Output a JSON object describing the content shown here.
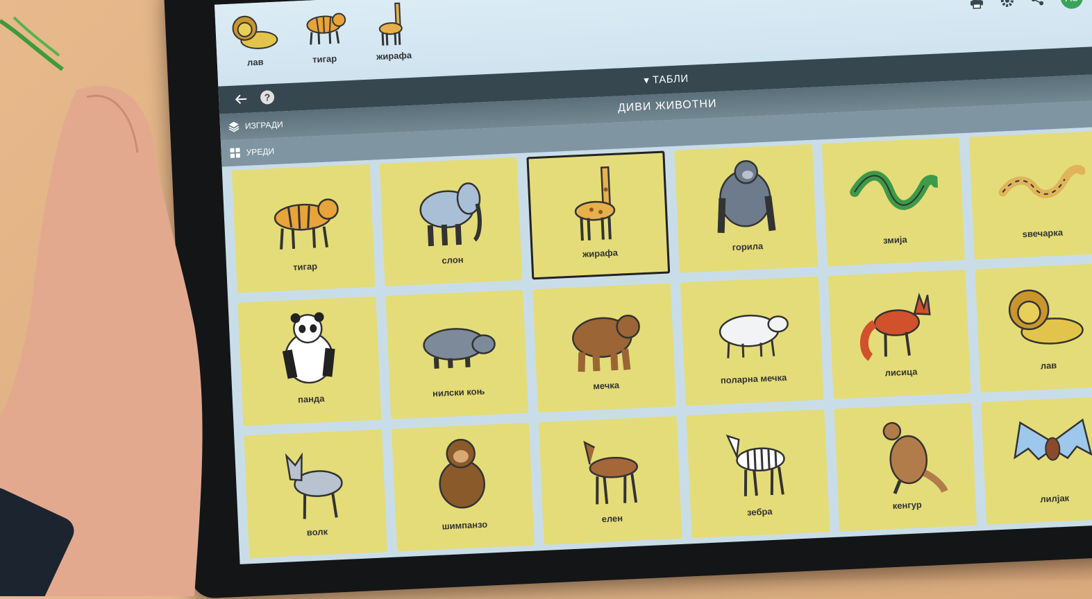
{
  "message_bar": {
    "items": [
      {
        "label": "лав",
        "icon": "lion-icon"
      },
      {
        "label": "тигар",
        "icon": "tiger-icon"
      },
      {
        "label": "жирафа",
        "icon": "giraffe-icon"
      }
    ],
    "avatar_initials": "AS",
    "tools": [
      "print-icon",
      "settings-icon",
      "share-icon"
    ]
  },
  "nav": {
    "boards_label": "ТАБЛИ"
  },
  "board": {
    "title": "ДИВИ ЖИВОТНИ",
    "build_label": "ИЗГРАДИ",
    "edit_label": "УРЕДИ"
  },
  "tiles": [
    {
      "label": "тигар",
      "icon": "tiger-icon",
      "color": "#e8a33a"
    },
    {
      "label": "слон",
      "icon": "elephant-icon",
      "color": "#a9bfd6"
    },
    {
      "label": "жирафа",
      "icon": "giraffe-icon",
      "color": "#e7b04a",
      "selected": true
    },
    {
      "label": "горила",
      "icon": "gorilla-icon",
      "color": "#6d7b8c"
    },
    {
      "label": "змија",
      "icon": "snake-icon",
      "color": "#3c9a48"
    },
    {
      "label": "ѕвечарка",
      "icon": "rattlesnake-icon",
      "color": "#e0b45a"
    },
    {
      "label": "панда",
      "icon": "panda-icon",
      "color": "#222222"
    },
    {
      "label": "нилски коњ",
      "icon": "hippo-icon",
      "color": "#7d8a99"
    },
    {
      "label": "мечка",
      "icon": "bear-icon",
      "color": "#9b6535"
    },
    {
      "label": "поларна мечка",
      "icon": "polar-bear-icon",
      "color": "#f1f3f4"
    },
    {
      "label": "лисица",
      "icon": "fox-icon",
      "color": "#d0512b"
    },
    {
      "label": "лав",
      "icon": "lion-icon",
      "color": "#e2c44a"
    },
    {
      "label": "волк",
      "icon": "wolf-icon",
      "color": "#b8c3cf"
    },
    {
      "label": "шимпанзо",
      "icon": "chimpanzee-icon",
      "color": "#8b5a2b"
    },
    {
      "label": "елен",
      "icon": "deer-icon",
      "color": "#a4673a"
    },
    {
      "label": "зебра",
      "icon": "zebra-icon",
      "color": "#ffffff"
    },
    {
      "label": "кенгур",
      "icon": "kangaroo-icon",
      "color": "#b27c4a"
    },
    {
      "label": "лилјак",
      "icon": "bat-icon",
      "color": "#9ec7ec"
    }
  ],
  "colors": {
    "tile_bg": "#e4dc78",
    "nav_bg": "#37474f",
    "avatar_bg": "#3aa35b"
  }
}
